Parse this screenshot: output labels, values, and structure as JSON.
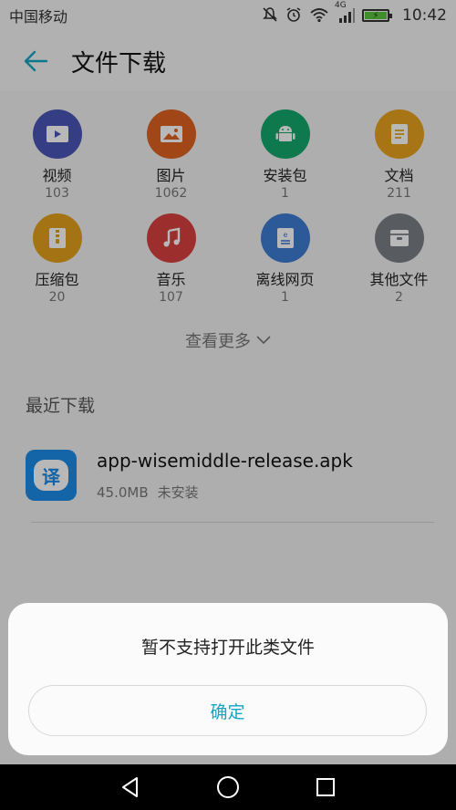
{
  "status_bar": {
    "carrier": "中国移动",
    "network": "4G",
    "time": "10:42",
    "icons": [
      "mute-icon",
      "alarm-icon",
      "wifi-icon",
      "signal-icon",
      "battery-charging-icon"
    ]
  },
  "app_bar": {
    "back_icon": "arrow-left-icon",
    "title": "文件下载"
  },
  "categories": [
    {
      "label": "视频",
      "count": "103",
      "icon": "video-icon",
      "color": "#4a56b8"
    },
    {
      "label": "图片",
      "count": "1062",
      "icon": "image-icon",
      "color": "#e0621f"
    },
    {
      "label": "安装包",
      "count": "1",
      "icon": "android-icon",
      "color": "#16a86c"
    },
    {
      "label": "文档",
      "count": "211",
      "icon": "document-icon",
      "color": "#e8a21e"
    },
    {
      "label": "压缩包",
      "count": "20",
      "icon": "archive-icon",
      "color": "#e3a11c"
    },
    {
      "label": "音乐",
      "count": "107",
      "icon": "music-icon",
      "color": "#d9403f"
    },
    {
      "label": "离线网页",
      "count": "1",
      "icon": "webpage-icon",
      "color": "#3d7cd1"
    },
    {
      "label": "其他文件",
      "count": "2",
      "icon": "other-file-icon",
      "color": "#7a7f86"
    }
  ],
  "more": {
    "label": "查看更多",
    "icon": "chevron-down-icon"
  },
  "recent": {
    "title": "最近下载",
    "files": [
      {
        "name": "app-wisemiddle-release.apk",
        "size": "45.0MB",
        "status": "未安装",
        "icon_text": "译",
        "icon_color": "#1d8de8"
      }
    ]
  },
  "dialog": {
    "message": "暂不支持打开此类文件",
    "button": "确定",
    "accent": "#13a5c4"
  },
  "nav": {
    "back_icon": "nav-back-icon",
    "home_icon": "nav-home-icon",
    "recents_icon": "nav-recents-icon"
  }
}
